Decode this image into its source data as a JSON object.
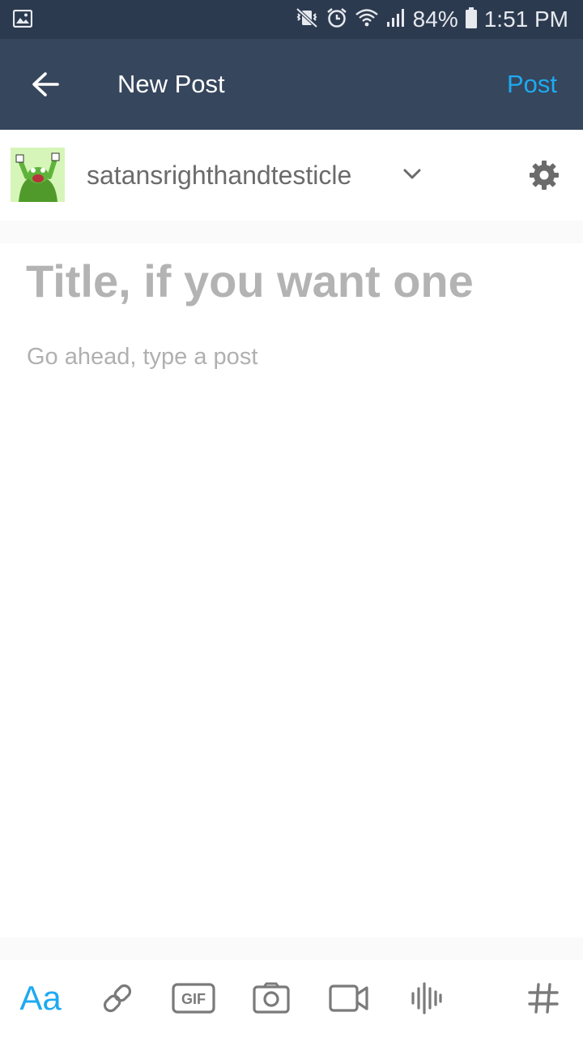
{
  "status_bar": {
    "battery": "84%",
    "time": "1:51 PM"
  },
  "header": {
    "title": "New Post",
    "post_label": "Post"
  },
  "blog": {
    "name": "satansrighthandtesticle"
  },
  "editor": {
    "title_placeholder": "Title, if you want one",
    "body_placeholder": "Go ahead, type a post"
  },
  "toolbar": {
    "text_label": "Aa",
    "gif_label": "GIF"
  },
  "colors": {
    "status_bar": "#2c3a4f",
    "app_bar": "#36465d",
    "accent": "#1eaaf1",
    "placeholder": "#b3b3b3"
  }
}
